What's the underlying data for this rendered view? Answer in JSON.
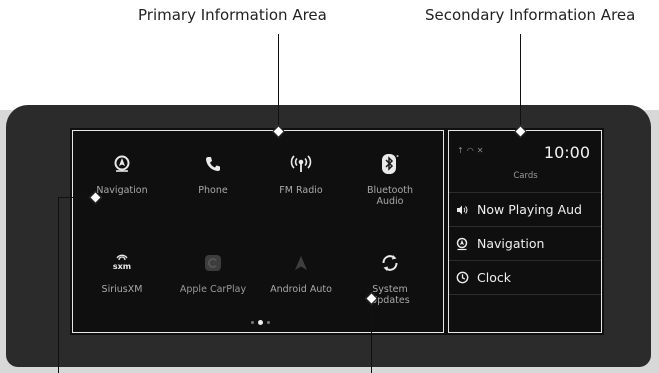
{
  "callouts": {
    "primary": "Primary Information Area",
    "secondary": "Secondary Information Area"
  },
  "primary_area": {
    "apps": [
      {
        "label": "Navigation",
        "icon": "navigation-icon"
      },
      {
        "label": "Phone",
        "icon": "phone-icon"
      },
      {
        "label": "FM Radio",
        "icon": "radio-icon"
      },
      {
        "label": "Bluetooth\nAudio",
        "icon": "bluetooth-icon"
      },
      {
        "label": "SiriusXM",
        "icon": "siriusxm-icon"
      },
      {
        "label": "Apple CarPlay",
        "icon": "carplay-icon"
      },
      {
        "label": "Android Auto",
        "icon": "android-auto-icon"
      },
      {
        "label": "System\nUpdates",
        "icon": "system-updates-icon"
      }
    ],
    "page_count": 3,
    "current_page": 2
  },
  "secondary_area": {
    "time": "10:00",
    "cards_title": "Cards",
    "cards": [
      {
        "label": "Now Playing Aud",
        "icon": "speaker-icon"
      },
      {
        "label": "Navigation",
        "icon": "navigation-icon"
      },
      {
        "label": "Clock",
        "icon": "clock-icon"
      }
    ]
  }
}
